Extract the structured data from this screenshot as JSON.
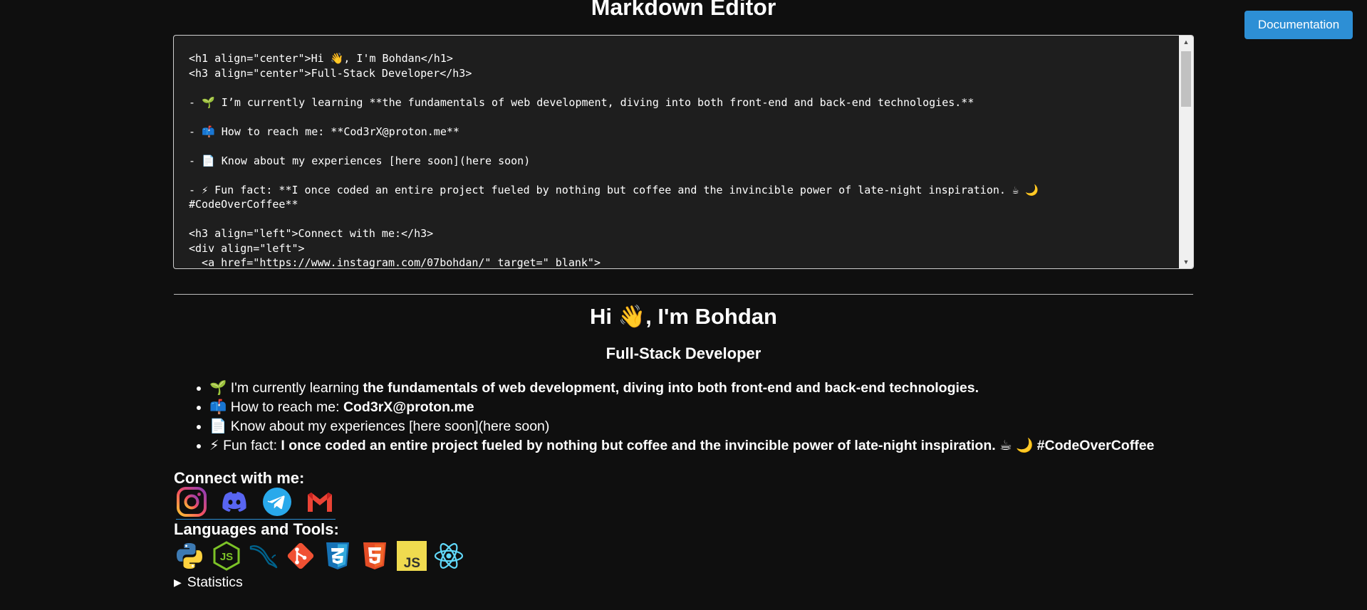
{
  "header": {
    "title": "Markdown Editor",
    "doc_button": "Documentation"
  },
  "editor": {
    "content": "<h1 align=\"center\">Hi 👋, I'm Bohdan</h1>\n<h3 align=\"center\">Full-Stack Developer</h3>\n\n- 🌱 I’m currently learning **the fundamentals of web development, diving into both front-end and back-end technologies.**\n\n- 📫 How to reach me: **Cod3rX@proton.me**\n\n- 📄 Know about my experiences [here soon](here soon)\n\n- ⚡ Fun fact: **I once coded an entire project fueled by nothing but coffee and the invincible power of late-night inspiration. ☕ 🌙\n#CodeOverCoffee**\n\n<h3 align=\"left\">Connect with me:</h3>\n<div align=\"left\">\n  <a href=\"https://www.instagram.com/07bohdan/\" target=\"_blank\">"
  },
  "preview": {
    "h1": "Hi 👋, I'm Bohdan",
    "h3": "Full-Stack Developer",
    "items": [
      {
        "emoji": "🌱",
        "text": "I'm currently learning ",
        "bold": "the fundamentals of web development, diving into both front-end and back-end technologies."
      },
      {
        "emoji": "📫",
        "text": "How to reach me: ",
        "bold": "Cod3rX@proton.me"
      },
      {
        "emoji": "📄",
        "text": "Know about my experiences [here soon](here soon)",
        "bold": ""
      },
      {
        "emoji": "⚡",
        "text": "Fun fact: ",
        "bold": "I once coded an entire project fueled by nothing but coffee and the invincible power of late-night inspiration. ☕ 🌙 #CodeOverCoffee"
      }
    ],
    "connect_heading": "Connect with me:",
    "social_icons": [
      "instagram-icon",
      "discord-icon",
      "telegram-icon",
      "gmail-icon"
    ],
    "tools_heading": "Languages and Tools:",
    "tool_icons": [
      "python-icon",
      "nodejs-icon",
      "mysql-icon",
      "git-icon",
      "css3-icon",
      "html5-icon",
      "javascript-icon",
      "react-icon"
    ],
    "tools_js_text": "JS",
    "tools_node_text": "JS",
    "statistics": "Statistics"
  },
  "colors": {
    "background": "#0f0f0f",
    "accent": "#2d8fd5",
    "editor_bg": "#1e1e1e"
  }
}
